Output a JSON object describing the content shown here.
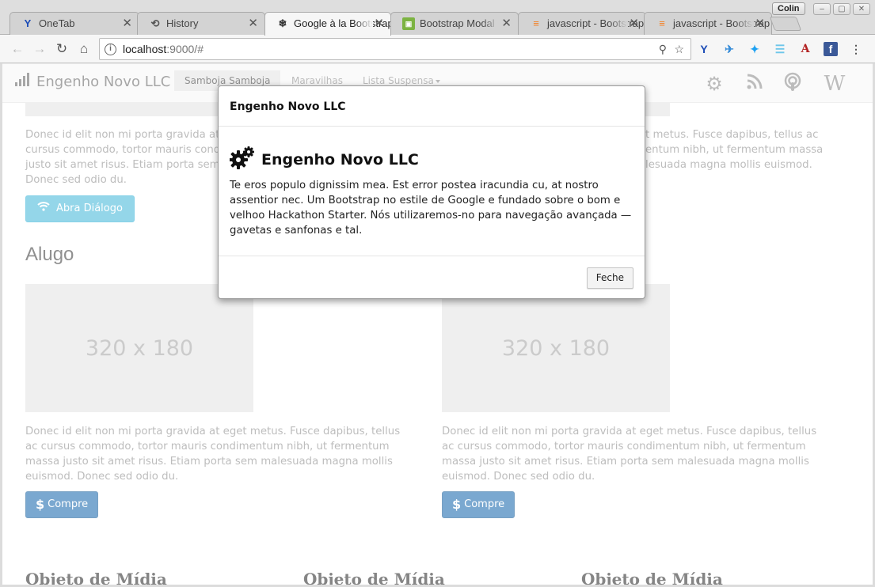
{
  "browser": {
    "tabs": [
      {
        "title": "OneTab",
        "icon": "onetab-icon",
        "glyph": "Y",
        "color": "#1b4bb6"
      },
      {
        "title": "History",
        "icon": "history-icon",
        "glyph": "⟲",
        "color": "#555555"
      },
      {
        "title": "Google à la Bootstrap",
        "icon": "snowflake-icon",
        "glyph": "❄",
        "color": "#333333"
      },
      {
        "title": "Bootstrap Modal",
        "icon": "bootstrap-modal-icon",
        "glyph": "▣",
        "color": "#7cb342"
      },
      {
        "title": "javascript - Bootstrap",
        "icon": "stackoverflow-icon",
        "glyph": "≡",
        "color": "#f48024"
      },
      {
        "title": "javascript - Bootstrap",
        "icon": "stackoverflow-icon",
        "glyph": "≡",
        "color": "#f48024"
      }
    ],
    "close_glyph": "✕",
    "profile": "Colin",
    "url_host": "localhost",
    "url_rest": ":9000/#"
  },
  "nav": {
    "brand": "Engenho Novo LLC",
    "links": [
      "Samboja Samboja",
      "Maravilhas",
      "Lista Suspensa"
    ]
  },
  "content": {
    "paragraph": "Donec id elit non mi porta gravida at eget metus. Fusce dapibus, tellus ac cursus commodo, tortor mauris condimentum nibh, ut fermentum massa justo sit amet risus. Etiam porta sem malesuada magna mollis euismod. Donec sed odio du.",
    "para_top_left_visible": "Donec id elit non mi porta gravida at e",
    "para_top_left_l2": "cursus commodo, tortor mauris condi",
    "para_top_left_l3": "justo sit amet risus. Etiam porta sem m",
    "para_top_left_l4": "Donec sed odio du.",
    "para_top_right_l1": "t metus. Fusce dapibus, tellus ac",
    "para_top_right_l2": "entum nibh, ut fermentum massa",
    "para_top_right_l3": "lesuada magna mollis euismod.",
    "dialog_button": "Abra Diálogo",
    "section_heading": "Alugo",
    "thumb_label": "320 x 180",
    "buy_button": "Compre",
    "media_heading": "Objeto de Mídia"
  },
  "modal": {
    "header": "Engenho Novo LLC",
    "title": "Engenho Novo LLC",
    "text": "Te eros populo dignissim mea. Est error postea iracundia cu, at nostro assentior nec. Um Bootstrap no estile de Google e fundado sobre o bom e velhoo Hackathon Starter. Nós utilizaremos-no para navegação avançada — gavetas e sanfonas e tal.",
    "close_button": "Feche"
  },
  "colors": {
    "info": "#5bc0de",
    "primary": "#337ab7"
  }
}
